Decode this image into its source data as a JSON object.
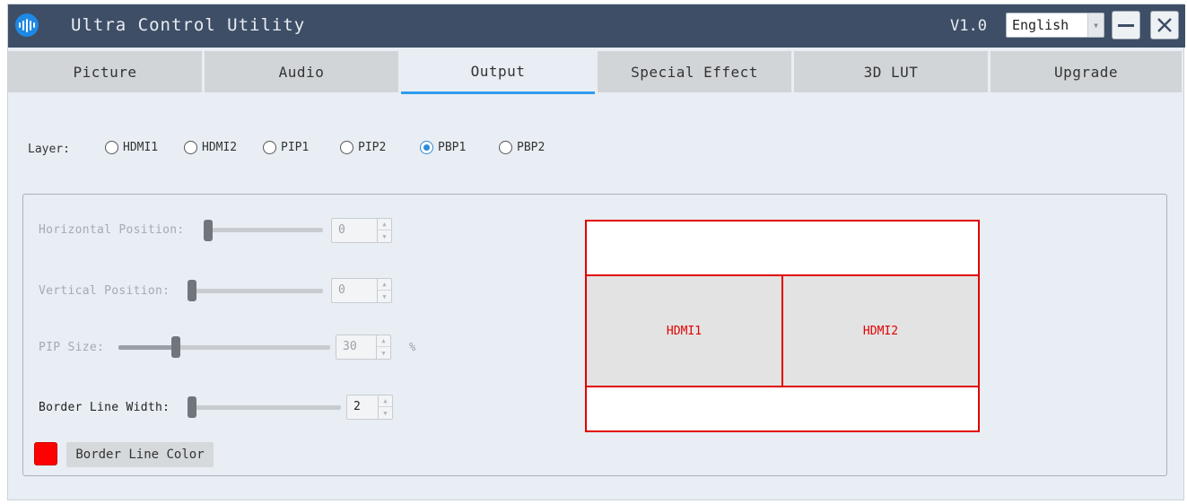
{
  "window": {
    "title": "Ultra Control Utility",
    "version": "V1.0",
    "language": {
      "selected": "English"
    },
    "icons": {
      "app": "sound-wave-icon",
      "minimize": "minimize-icon",
      "close": "close-icon"
    }
  },
  "tabs": [
    {
      "label": "Picture",
      "active": false
    },
    {
      "label": "Audio",
      "active": false
    },
    {
      "label": "Output",
      "active": true
    },
    {
      "label": "Special Effect",
      "active": false
    },
    {
      "label": "3D LUT",
      "active": false
    },
    {
      "label": "Upgrade",
      "active": false
    }
  ],
  "layer": {
    "label": "Layer:",
    "options": [
      {
        "label": "HDMI1",
        "checked": false
      },
      {
        "label": "HDMI2",
        "checked": false
      },
      {
        "label": "PIP1",
        "checked": false
      },
      {
        "label": "PIP2",
        "checked": false
      },
      {
        "label": "PBP1",
        "checked": true
      },
      {
        "label": "PBP2",
        "checked": false
      }
    ]
  },
  "controls": {
    "horizontal_position": {
      "label": "Horizontal Position:",
      "value": "0",
      "enabled": false,
      "fraction": 0.0
    },
    "vertical_position": {
      "label": "Vertical Position:",
      "value": "0",
      "enabled": false,
      "fraction": 0.0
    },
    "pip_size": {
      "label": "PIP Size:",
      "value": "30",
      "unit": "%",
      "enabled": false,
      "fraction": 0.3
    },
    "border_line_width": {
      "label": "Border Line Width:",
      "value": "2",
      "enabled": true,
      "fraction": 0.0
    },
    "border_line_color": {
      "button_label": "Border Line Color",
      "color": "#ff0000"
    }
  },
  "preview": {
    "left_label": "HDMI1",
    "right_label": "HDMI2",
    "border_color": "#e10000"
  },
  "colors": {
    "titlebar": "#3d4e66",
    "active_tab_underline": "#2e9bf0",
    "radio_checked": "#2e8ad8"
  }
}
